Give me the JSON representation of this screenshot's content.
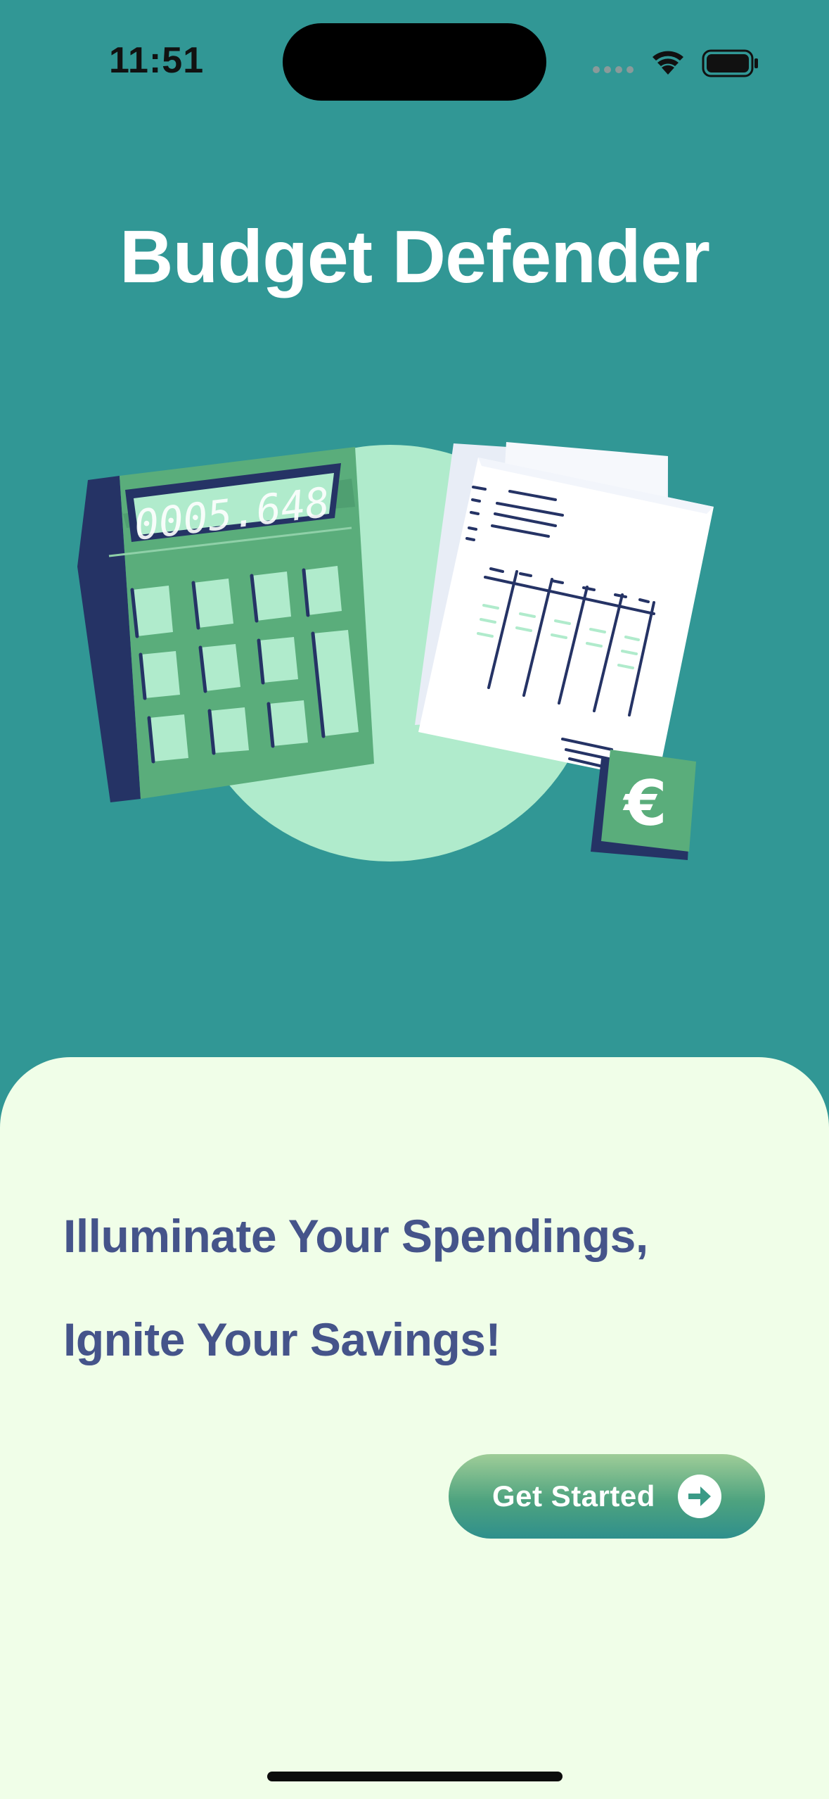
{
  "status_bar": {
    "time": "11:51",
    "icons": [
      "signal-dots-icon",
      "wifi-icon",
      "battery-icon"
    ]
  },
  "app": {
    "title": "Budget Defender"
  },
  "hero": {
    "calculator_display": "0005.648",
    "currency_symbol": "€",
    "icons": [
      "calculator-icon",
      "receipt-icon",
      "euro-badge-icon"
    ]
  },
  "onboarding": {
    "tagline_line1": "Illuminate Your Spendings,",
    "tagline_line2": "Ignite Your Savings!",
    "cta_label": "Get Started",
    "cta_icon": "arrow-right-circle-icon"
  },
  "colors": {
    "background": "#319795",
    "sheet": "#f0fee8",
    "tagline": "#45548a",
    "accent_green": "#5aad7b",
    "light_mint": "#b0ebcc",
    "navy": "#253365"
  }
}
